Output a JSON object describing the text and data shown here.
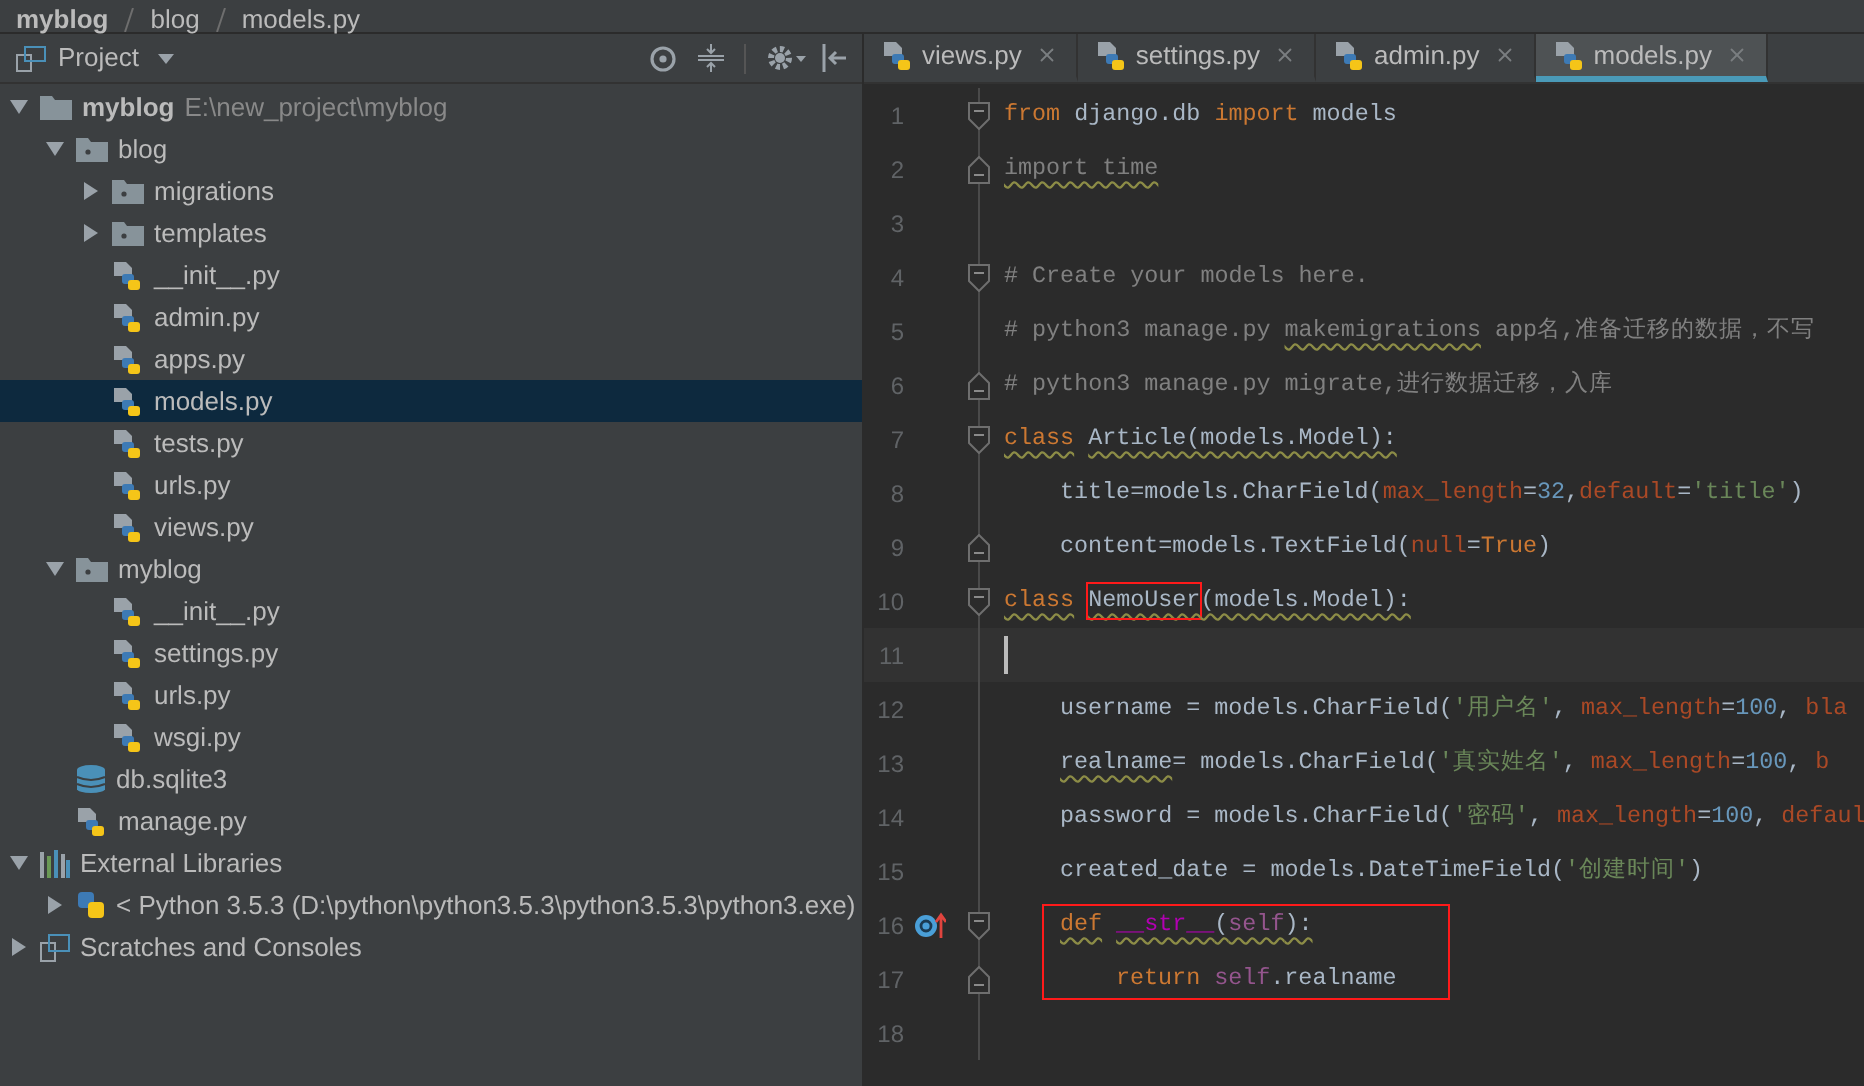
{
  "breadcrumb": [
    "myblog",
    "blog",
    "models.py"
  ],
  "project_panel": {
    "title": "Project"
  },
  "tree": [
    {
      "kind": "project",
      "label": "myblog",
      "path": "E:\\new_project\\myblog",
      "expanded": true,
      "selected": false,
      "children": [
        {
          "kind": "package",
          "label": "blog",
          "expanded": true,
          "selected": false,
          "children": [
            {
              "kind": "package",
              "label": "migrations",
              "expanded": false,
              "selected": false
            },
            {
              "kind": "package",
              "label": "templates",
              "expanded": false,
              "selected": false
            },
            {
              "kind": "pyfile",
              "label": "__init__.py",
              "selected": false
            },
            {
              "kind": "pyfile",
              "label": "admin.py",
              "selected": false
            },
            {
              "kind": "pyfile",
              "label": "apps.py",
              "selected": false
            },
            {
              "kind": "pyfile",
              "label": "models.py",
              "selected": true
            },
            {
              "kind": "pyfile",
              "label": "tests.py",
              "selected": false
            },
            {
              "kind": "pyfile",
              "label": "urls.py",
              "selected": false
            },
            {
              "kind": "pyfile",
              "label": "views.py",
              "selected": false
            }
          ]
        },
        {
          "kind": "package",
          "label": "myblog",
          "expanded": true,
          "selected": false,
          "children": [
            {
              "kind": "pyfile",
              "label": "__init__.py",
              "selected": false
            },
            {
              "kind": "pyfile",
              "label": "settings.py",
              "selected": false
            },
            {
              "kind": "pyfile",
              "label": "urls.py",
              "selected": false
            },
            {
              "kind": "pyfile",
              "label": "wsgi.py",
              "selected": false
            }
          ]
        },
        {
          "kind": "database",
          "label": "db.sqlite3",
          "selected": false
        },
        {
          "kind": "pyfile",
          "label": "manage.py",
          "selected": false
        }
      ]
    },
    {
      "kind": "libraries",
      "label": "External Libraries",
      "expanded": true,
      "selected": false,
      "children": [
        {
          "kind": "sdk",
          "label": "< Python 3.5.3 (D:\\python\\python3.5.3\\python3.5.3\\python3.exe)",
          "expanded": false,
          "selected": false
        }
      ]
    },
    {
      "kind": "scratches",
      "label": "Scratches and Consoles",
      "expanded": false,
      "selected": false
    }
  ],
  "tabs": [
    {
      "label": "views.py",
      "selected": false
    },
    {
      "label": "settings.py",
      "selected": false
    },
    {
      "label": "admin.py",
      "selected": false
    },
    {
      "label": "models.py",
      "selected": true
    }
  ],
  "lines": [
    {
      "n": "1",
      "fold_start": true,
      "tokens": [
        {
          "text": "from",
          "kind": "kw"
        },
        {
          "text": "django.db",
          "kind": "plain"
        },
        {
          "text": "import",
          "kind": "kw"
        },
        {
          "text": "models",
          "kind": "plain"
        }
      ]
    },
    {
      "n": "2",
      "fold_end": true,
      "tokens": [
        {
          "text": "import time",
          "kind": "unused",
          "warning": true
        }
      ]
    },
    {
      "n": "3"
    },
    {
      "n": "4",
      "fold_start": true,
      "tokens": [
        {
          "text": "# Create your models here.",
          "kind": "comment"
        }
      ]
    },
    {
      "n": "5",
      "tokens": [
        {
          "text": "# python3 manage.py",
          "kind": "comment"
        },
        {
          "text": "makemigrations",
          "kind": "comment",
          "warning": true
        },
        {
          "text": "app名,准备迁移的数据，不写",
          "kind": "comment"
        }
      ]
    },
    {
      "n": "6",
      "fold_end": true,
      "tokens": [
        {
          "text": "# python3 manage.py migrate,进行数据迁移，入库",
          "kind": "comment"
        }
      ]
    },
    {
      "n": "7",
      "fold_start": true,
      "tokens": [
        {
          "text": "class",
          "kind": "kw",
          "warning": true
        },
        {
          "text": "Article(models.Model):",
          "kind": "plain",
          "warning": true
        }
      ],
      "children": [
        {
          "n": "8",
          "tokens": [
            {
              "text": "title=models.CharField(",
              "kind": "plain"
            },
            {
              "text": "max_length",
              "kind": "param"
            },
            {
              "text": "=",
              "kind": "plain"
            },
            {
              "text": "32",
              "kind": "num"
            },
            {
              "text": ",",
              "kind": "plain"
            },
            {
              "text": "default",
              "kind": "param"
            },
            {
              "text": "=",
              "kind": "plain"
            },
            {
              "text": "'title'",
              "kind": "str"
            },
            {
              "text": ")",
              "kind": "plain"
            }
          ]
        },
        {
          "n": "9",
          "fold_end": true,
          "tokens": [
            {
              "text": "content=models.TextField(",
              "kind": "plain"
            },
            {
              "text": "null",
              "kind": "param"
            },
            {
              "text": "=",
              "kind": "plain"
            },
            {
              "text": "True",
              "kind": "kw"
            },
            {
              "text": ")",
              "kind": "plain"
            }
          ]
        }
      ]
    },
    {
      "n": "10",
      "fold_start": true,
      "tokens": [
        {
          "text": "class",
          "kind": "kw",
          "warning": true
        },
        {
          "text": "NemoUser",
          "kind": "plain",
          "warning": true,
          "boxed": true
        },
        {
          "text": "(models.Model):",
          "kind": "plain",
          "warning": true
        }
      ],
      "children": [
        {
          "n": "11",
          "current": true
        },
        {
          "n": "12",
          "tokens": [
            {
              "text": "username = models.CharField(",
              "kind": "plain"
            },
            {
              "text": "'用户名'",
              "kind": "str"
            },
            {
              "text": ",",
              "kind": "plain"
            },
            {
              "text": "max_length",
              "kind": "param"
            },
            {
              "text": "=",
              "kind": "plain"
            },
            {
              "text": "100",
              "kind": "num"
            },
            {
              "text": ",",
              "kind": "plain"
            },
            {
              "text": "bla",
              "kind": "param"
            }
          ]
        },
        {
          "n": "13",
          "tokens": [
            {
              "text": "realname",
              "kind": "plain",
              "warning": true
            },
            {
              "text": "= models.CharField(",
              "kind": "plain"
            },
            {
              "text": "'真实姓名'",
              "kind": "str"
            },
            {
              "text": ",",
              "kind": "plain"
            },
            {
              "text": "max_length",
              "kind": "param"
            },
            {
              "text": "=",
              "kind": "plain"
            },
            {
              "text": "100",
              "kind": "num"
            },
            {
              "text": ",",
              "kind": "plain"
            },
            {
              "text": "b",
              "kind": "param"
            }
          ]
        },
        {
          "n": "14",
          "tokens": [
            {
              "text": "password = models.CharField(",
              "kind": "plain"
            },
            {
              "text": "'密码'",
              "kind": "str"
            },
            {
              "text": ",",
              "kind": "plain"
            },
            {
              "text": "max_length",
              "kind": "param"
            },
            {
              "text": "=",
              "kind": "plain"
            },
            {
              "text": "100",
              "kind": "num"
            },
            {
              "text": ",",
              "kind": "plain"
            },
            {
              "text": "defaul",
              "kind": "param"
            }
          ]
        },
        {
          "n": "15",
          "tokens": [
            {
              "text": "created_date = models.DateTimeField(",
              "kind": "plain"
            },
            {
              "text": "'创建时间'",
              "kind": "str"
            },
            {
              "text": ")",
              "kind": "plain"
            }
          ]
        },
        {
          "n": "16",
          "fold_start": true,
          "override": true,
          "boxed": true,
          "tokens": [
            {
              "text": "def",
              "kind": "kw",
              "warning": true
            },
            {
              "text": "__str__",
              "kind": "magic",
              "warning": true
            },
            {
              "text": "(",
              "kind": "plain",
              "warning": true
            },
            {
              "text": "self",
              "kind": "self",
              "warning": true
            },
            {
              "text": "):",
              "kind": "plain",
              "warning": true
            }
          ],
          "children": [
            {
              "n": "17",
              "fold_end": true,
              "boxed": true,
              "tokens": [
                {
                  "text": "return",
                  "kind": "kw"
                },
                {
                  "text": "self",
                  "kind": "self"
                },
                {
                  "text": ".realname",
                  "kind": "plain"
                }
              ]
            }
          ]
        }
      ]
    },
    {
      "n": "18"
    }
  ]
}
